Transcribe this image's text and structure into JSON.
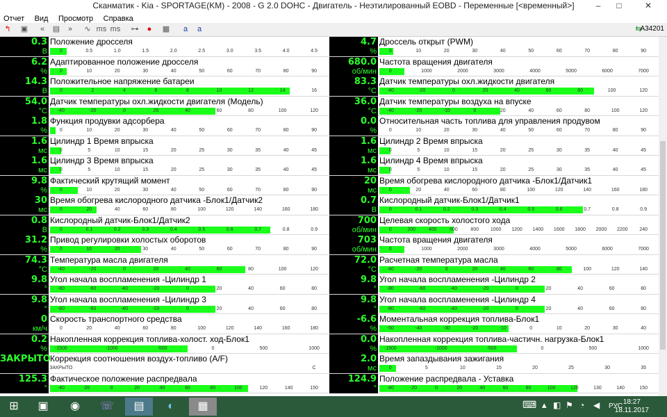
{
  "window": {
    "title": "Сканматик - Kia - SPORTAGE(KM) - 2008 - G 2.0 DOHC - Двигатель - Неэтилированный EOBD - Переменные [<временный>]"
  },
  "menu": [
    "Отчет",
    "Вид",
    "Просмотр",
    "Справка"
  ],
  "toolbar": {
    "ms_label": "ms",
    "ms2_label": "ms",
    "font_a_label": "a",
    "font_b_label": "a",
    "device_id": "A34201"
  },
  "left": [
    {
      "value": "0.3",
      "unit": "В",
      "name": "Положение дросселя",
      "fill": 0.06,
      "ticks": [
        "0",
        "0.5",
        "1.0",
        "1.5",
        "2.0",
        "2.5",
        "3.0",
        "3.5",
        "4.0",
        "4.5"
      ]
    },
    {
      "value": "6.2",
      "unit": "%",
      "name": "Адаптированное положение дросселя",
      "fill": 0.06,
      "ticks": [
        "0",
        "10",
        "20",
        "30",
        "40",
        "50",
        "60",
        "70",
        "80",
        "90"
      ]
    },
    {
      "value": "14.3",
      "unit": "В",
      "name": "Положительное напряжение батареи",
      "fill": 0.87,
      "ticks": [
        "0",
        "2",
        "4",
        "6",
        "8",
        "10",
        "12",
        "14",
        "16"
      ]
    },
    {
      "value": "54.0",
      "unit": "°C",
      "name": "Датчик температуры охл.жидкости двигателя (Модель)",
      "fill": 0.6,
      "ticks": [
        "-40",
        "-20",
        "0",
        "20",
        "40",
        "60",
        "80",
        "100",
        "120"
      ]
    },
    {
      "value": "1.8",
      "unit": "%",
      "name": "Функция продувки адсорбера",
      "fill": 0.02,
      "ticks": [
        "0",
        "10",
        "20",
        "30",
        "40",
        "50",
        "60",
        "70",
        "80",
        "90"
      ]
    },
    {
      "value": "1.6",
      "unit": "мс",
      "name": "Цилиндр 1 Время впрыска",
      "fill": 0.04,
      "ticks": [
        "0",
        "5",
        "10",
        "15",
        "20",
        "25",
        "30",
        "35",
        "40",
        "45"
      ]
    },
    {
      "value": "1.6",
      "unit": "мс",
      "name": "Цилиндр 3 Время впрыска",
      "fill": 0.04,
      "ticks": [
        "0",
        "5",
        "10",
        "15",
        "20",
        "25",
        "30",
        "35",
        "40",
        "45"
      ]
    },
    {
      "value": "9.8",
      "unit": "%",
      "name": "Фактический крутящий момент",
      "fill": 0.1,
      "ticks": [
        "0",
        "10",
        "20",
        "30",
        "40",
        "50",
        "60",
        "70",
        "80",
        "90"
      ]
    },
    {
      "value": "30",
      "unit": "мс",
      "name": "Время обогрева кислородного датчика -Блок1/Датчик2",
      "fill": 0.17,
      "ticks": [
        "0",
        "20",
        "40",
        "60",
        "80",
        "100",
        "120",
        "140",
        "160",
        "180"
      ]
    },
    {
      "value": "0.8",
      "unit": "В",
      "name": "Кислородный датчик-Блок1/Датчик2",
      "fill": 0.8,
      "ticks": [
        "0",
        "0.1",
        "0.2",
        "0.3",
        "0.4",
        "0.5",
        "0.6",
        "0.7",
        "0.8",
        "0.9"
      ]
    },
    {
      "value": "31.2",
      "unit": "%",
      "name": "Привод регулировки холостых оборотов",
      "fill": 0.33,
      "ticks": [
        "0",
        "10",
        "20",
        "30",
        "40",
        "50",
        "60",
        "70",
        "80",
        "90"
      ]
    },
    {
      "value": "74.3",
      "unit": "°C",
      "name": "Температура масла двигателя",
      "fill": 0.71,
      "ticks": [
        "-40",
        "-20",
        "0",
        "20",
        "40",
        "60",
        "80",
        "100",
        "120"
      ]
    },
    {
      "value": "9.8",
      "unit": "°",
      "name": "Угол начала воспламенения -Цилиндр 1",
      "fill": 0.6,
      "ticks": [
        "-80",
        "-60",
        "-40",
        "-20",
        "0",
        "20",
        "40",
        "60",
        "80"
      ]
    },
    {
      "value": "9.8",
      "unit": "°",
      "name": "Угол начала воспламенения -Цилиндр 3",
      "fill": 0.6,
      "ticks": [
        "-80",
        "-60",
        "-40",
        "-20",
        "0",
        "20",
        "40",
        "60",
        "80"
      ]
    },
    {
      "value": "0",
      "unit": "км/ч",
      "name": "Скорость транспортного средства",
      "fill": 0.0,
      "ticks": [
        "0",
        "20",
        "40",
        "60",
        "80",
        "100",
        "120",
        "140",
        "160",
        "180"
      ]
    },
    {
      "value": "0.2",
      "unit": "%",
      "name": "Накопленная коррекция топлива-холост. ход-Блок1",
      "fill": 0.5,
      "ticks": [
        "-1500",
        "-1000",
        "-500",
        "0",
        "500",
        "1000"
      ]
    },
    {
      "value": "ЗАКРЫТО",
      "unit": "",
      "name": "Коррекция соотношения воздух-топливо (A/F)",
      "fill": 0.0,
      "ticks": [
        "ЗАКРЫТО",
        "С"
      ]
    },
    {
      "value": "125.3",
      "unit": "°",
      "name": "Фактическое положение распредвала",
      "fill": 0.72,
      "ticks": [
        "-40",
        "-20",
        "0",
        "20",
        "40",
        "60",
        "80",
        "100",
        "120",
        "140",
        "150"
      ]
    }
  ],
  "right": [
    {
      "value": "4.7",
      "unit": "%",
      "name": "Дроссель открыт (PWM)",
      "fill": 0.05,
      "ticks": [
        "0",
        "10",
        "20",
        "30",
        "40",
        "50",
        "60",
        "70",
        "80",
        "90"
      ]
    },
    {
      "value": "680.0",
      "unit": "об/мин",
      "name": "Частота вращения двигателя",
      "fill": 0.09,
      "ticks": [
        "0",
        "1000",
        "2000",
        "3000",
        "4000",
        "5000",
        "6000",
        "7000"
      ]
    },
    {
      "value": "83.3",
      "unit": "°C",
      "name": "Датчик температуры охл.жидкости двигателя",
      "fill": 0.78,
      "ticks": [
        "-40",
        "-20",
        "0",
        "20",
        "40",
        "60",
        "80",
        "100",
        "120"
      ]
    },
    {
      "value": "36.0",
      "unit": "°C",
      "name": "Датчик температуры воздуха на впуске",
      "fill": 0.44,
      "ticks": [
        "-40",
        "-20",
        "-10",
        "0",
        "20",
        "40",
        "60",
        "80",
        "100",
        "120"
      ]
    },
    {
      "value": "0.0",
      "unit": "%",
      "name": "Относительная часть топлива для управления продувом",
      "fill": 0.0,
      "ticks": [
        "0",
        "10",
        "20",
        "30",
        "40",
        "50",
        "60",
        "70",
        "80",
        "90"
      ]
    },
    {
      "value": "1.6",
      "unit": "мс",
      "name": "Цилиндр 2 Время впрыска",
      "fill": 0.04,
      "ticks": [
        "0",
        "5",
        "10",
        "15",
        "20",
        "25",
        "30",
        "35",
        "40",
        "45"
      ]
    },
    {
      "value": "1.6",
      "unit": "мс",
      "name": "Цилиндр 4 Время впрыска",
      "fill": 0.04,
      "ticks": [
        "0",
        "5",
        "10",
        "15",
        "20",
        "25",
        "30",
        "35",
        "40",
        "45"
      ]
    },
    {
      "value": "20",
      "unit": "мс",
      "name": "Время обогрева кислородного датчика -Блок1/Датчик1",
      "fill": 0.11,
      "ticks": [
        "0",
        "20",
        "40",
        "60",
        "80",
        "100",
        "120",
        "140",
        "160",
        "180"
      ]
    },
    {
      "value": "0.7",
      "unit": "В",
      "name": "Кислородный датчик-Блок1/Датчик1",
      "fill": 0.74,
      "ticks": [
        "0",
        "0.1",
        "0.2",
        "0.3",
        "0.4",
        "0.5",
        "0.6",
        "0.7",
        "0.8",
        "0.9"
      ]
    },
    {
      "value": "700",
      "unit": "об/мин",
      "name": "Целевая скорость холостого хода",
      "fill": 0.27,
      "ticks": [
        "0",
        "200",
        "400",
        "600",
        "800",
        "1000",
        "1200",
        "1400",
        "1600",
        "1800",
        "2000",
        "2200",
        "240"
      ]
    },
    {
      "value": "703",
      "unit": "об/мин",
      "name": "Частота вращения двигателя",
      "fill": 0.09,
      "ticks": [
        "0",
        "1000",
        "2000",
        "3000",
        "4000",
        "5000",
        "6000",
        "7000"
      ]
    },
    {
      "value": "72.0",
      "unit": "°C",
      "name": "Расчетная температура масла",
      "fill": 0.7,
      "ticks": [
        "-40",
        "-20",
        "0",
        "20",
        "40",
        "60",
        "80",
        "100",
        "120",
        "140"
      ]
    },
    {
      "value": "9.8",
      "unit": "°",
      "name": "Угол начала воспламенения -Цилиндр 2",
      "fill": 0.6,
      "ticks": [
        "-80",
        "-60",
        "-40",
        "-20",
        "0",
        "20",
        "40",
        "60",
        "80"
      ]
    },
    {
      "value": "9.8",
      "unit": "°",
      "name": "Угол начала воспламенения -Цилиндр 4",
      "fill": 0.6,
      "ticks": [
        "-80",
        "-60",
        "-40",
        "-20",
        "0",
        "20",
        "40",
        "60",
        "80"
      ]
    },
    {
      "value": "-6.6",
      "unit": "%",
      "name": "Моментальная коррекция топлива-Блок1",
      "fill": 0.47,
      "ticks": [
        "-50",
        "-40",
        "-30",
        "-20",
        "-10",
        "0",
        "10",
        "20",
        "30",
        "40"
      ]
    },
    {
      "value": "0.0",
      "unit": "%",
      "name": "Накопленная коррекция топлива-частичн. нагрузка-Блок1",
      "fill": 0.5,
      "ticks": [
        "-1500",
        "-1000",
        "-500",
        "0",
        "500",
        "1000"
      ]
    },
    {
      "value": "2.0",
      "unit": "мс",
      "name": "Время запаздывания зажигания",
      "fill": 0.06,
      "ticks": [
        "0",
        "5",
        "10",
        "15",
        "20",
        "25",
        "30",
        "35"
      ]
    },
    {
      "value": "124.9",
      "unit": "°",
      "name": "Положение распредвала - Уставка",
      "fill": 0.72,
      "ticks": [
        "-40",
        "-20",
        "0",
        "20",
        "40",
        "60",
        "80",
        "100",
        "120",
        "130",
        "140",
        "150"
      ]
    }
  ],
  "tray": {
    "language": "РУС",
    "time": "18:27",
    "date": "18.11.2017"
  },
  "colors": {
    "value_text": "#2cff2c",
    "value_bg": "#000000",
    "bar_fill": "#19ff19"
  }
}
